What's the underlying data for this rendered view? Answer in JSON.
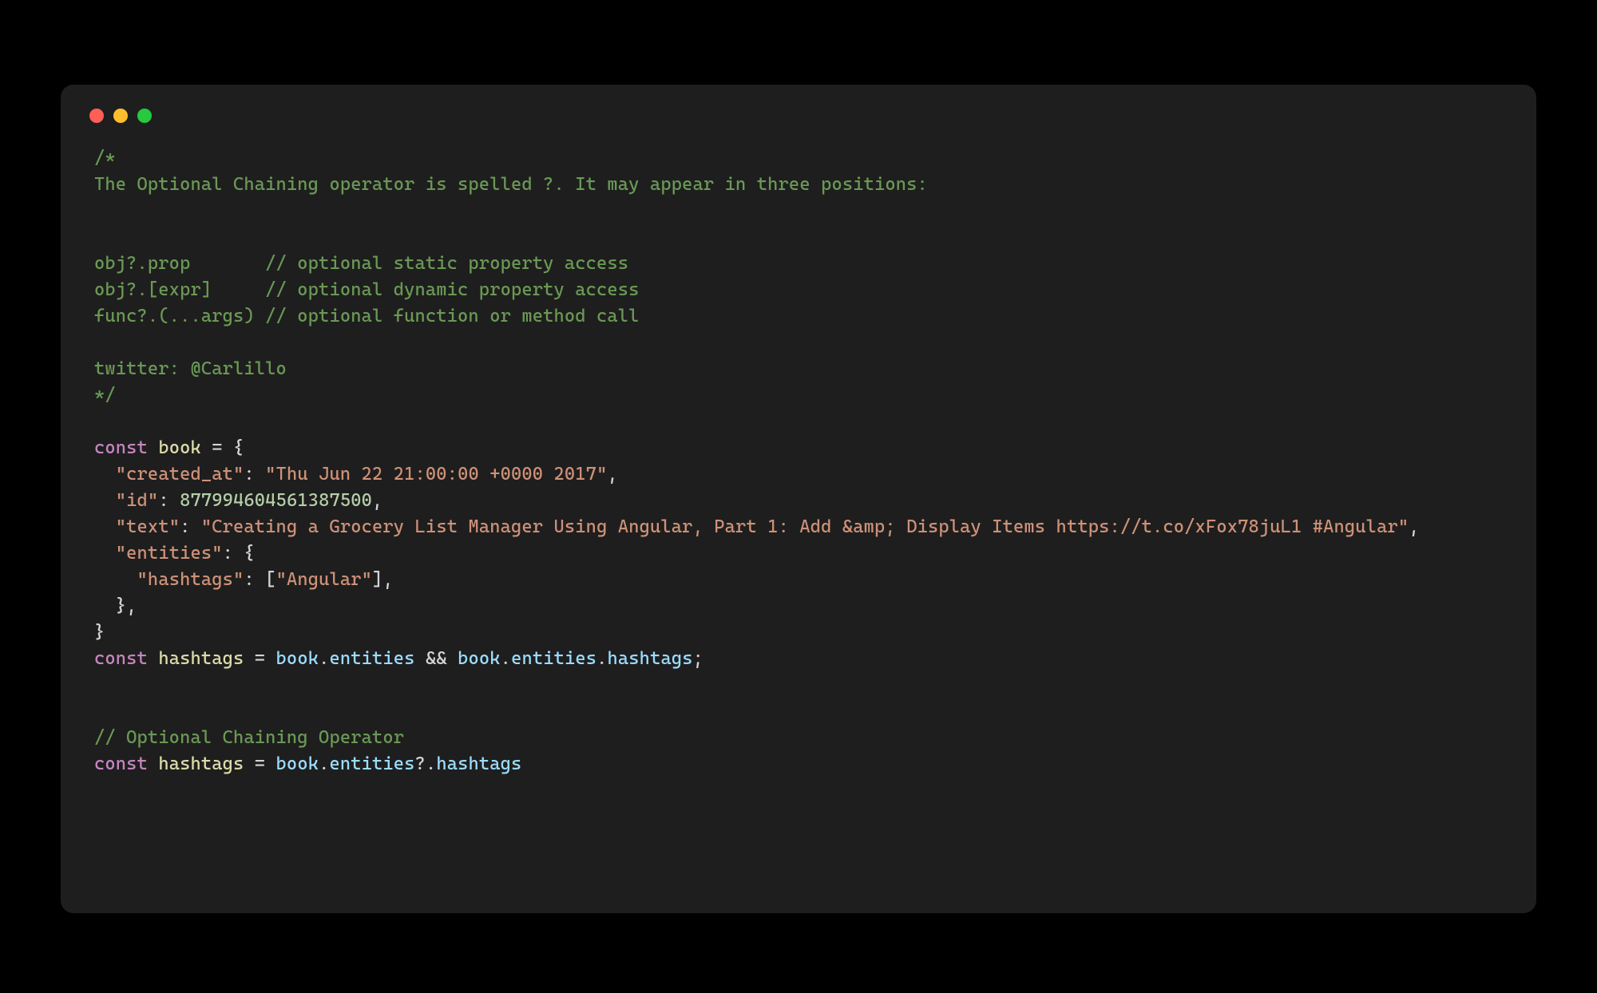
{
  "code": {
    "comment_open": "/*",
    "comment_l1": "The Optional Chaining operator is spelled ?. It may appear in three positions:",
    "comment_l2a": "obj?.prop       // optional static property access",
    "comment_l2b": "obj?.[expr]     // optional dynamic property access",
    "comment_l2c": "func?.(...args) // optional function or method call",
    "comment_twitter": "twitter: @Carlillo",
    "comment_close": "*/",
    "kw_const1": "const",
    "var_book": "book",
    "eq": " = ",
    "brace_open": "{",
    "key_created_at": "\"created_at\"",
    "val_created_at": "\"Thu Jun 22 21:00:00 +0000 2017\"",
    "key_id": "\"id\"",
    "val_id": "877994604561387500",
    "key_text": "\"text\"",
    "val_text": "\"Creating a Grocery List Manager Using Angular, Part 1: Add &amp; Display Items https://t.co/xFox78juL1 #Angular\"",
    "key_entities": "\"entities\"",
    "key_hashtags": "\"hashtags\"",
    "val_angular": "\"Angular\"",
    "brace_close": "}",
    "kw_const2": "const",
    "var_hashtags": "hashtags",
    "expr_book": "book",
    "expr_entities": "entities",
    "expr_hashtags": "hashtags",
    "amp": "&&",
    "comment_oco": "// Optional Chaining Operator",
    "kw_const3": "const",
    "qdot": "?.",
    "dot": ".",
    "colon": ": ",
    "comma": ",",
    "semi": ";",
    "bracket_open": "[",
    "bracket_close": "]"
  }
}
